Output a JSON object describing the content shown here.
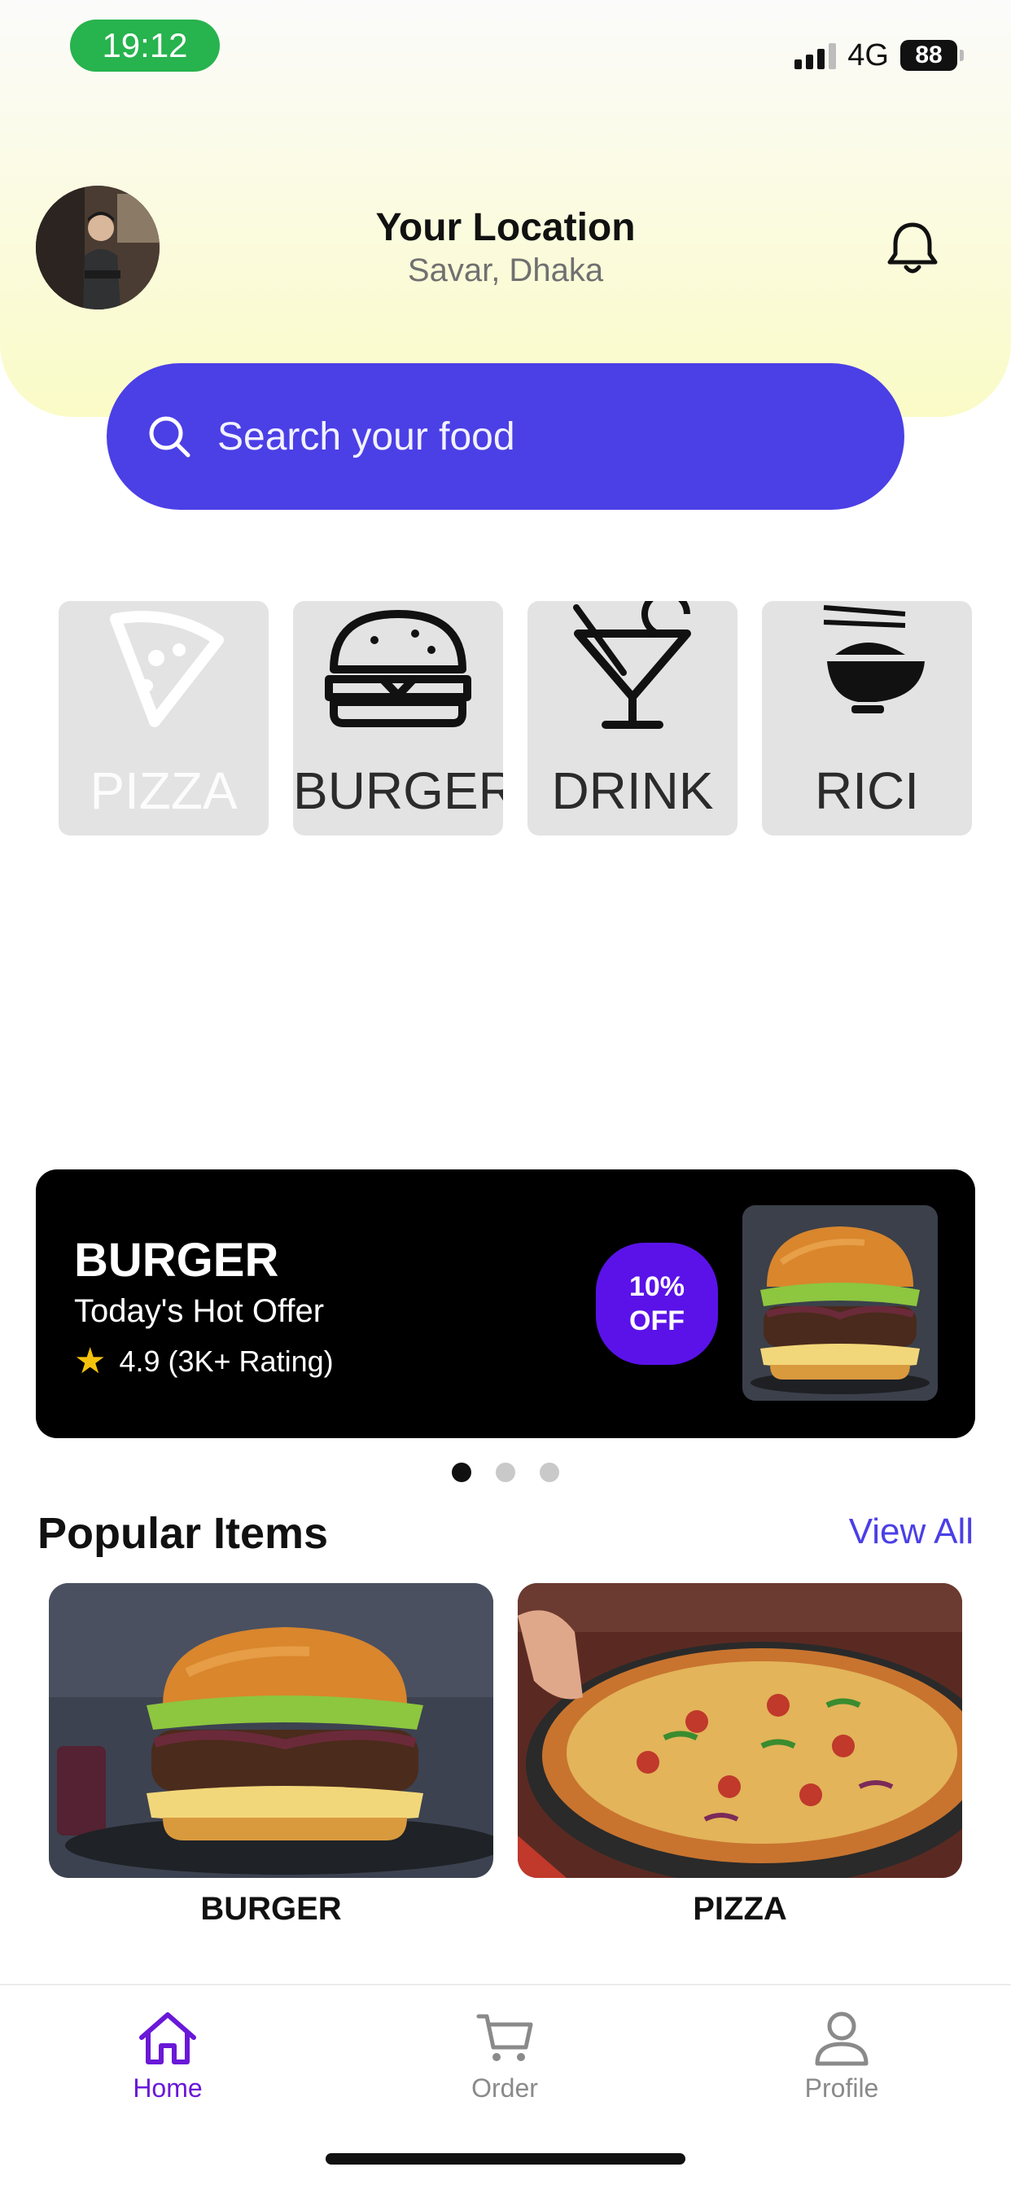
{
  "status_bar": {
    "time": "19:12",
    "network": "4G",
    "battery": "88"
  },
  "header": {
    "title": "Your Location",
    "location": "Savar, Dhaka"
  },
  "search": {
    "placeholder": "Search your food"
  },
  "categories": [
    {
      "label": "PIZZA",
      "icon": "pizza-icon"
    },
    {
      "label": "BURGER",
      "icon": "burger-icon"
    },
    {
      "label": "DRINK",
      "icon": "cocktail-icon"
    },
    {
      "label": "RICI",
      "icon": "rice-bowl-icon"
    }
  ],
  "offer": {
    "title": "BURGER",
    "subtitle": "Today's Hot Offer",
    "rating": "4.9 (3K+ Rating)",
    "discount_line1": "10%",
    "discount_line2": "OFF"
  },
  "carousel": {
    "pages": 3,
    "active": 0
  },
  "popular": {
    "title": "Popular Items",
    "view_all": "View All",
    "items": [
      {
        "label": "BURGER"
      },
      {
        "label": "PIZZA"
      }
    ]
  },
  "bottom_nav": [
    {
      "label": "Home",
      "icon": "home-icon",
      "active": true
    },
    {
      "label": "Order",
      "icon": "cart-icon",
      "active": false
    },
    {
      "label": "Profile",
      "icon": "user-icon",
      "active": false
    }
  ],
  "colors": {
    "accent": "#4b3fe6",
    "discount": "#5a12e8",
    "nav_active": "#6a18d8",
    "status_pill": "#27b34d"
  }
}
